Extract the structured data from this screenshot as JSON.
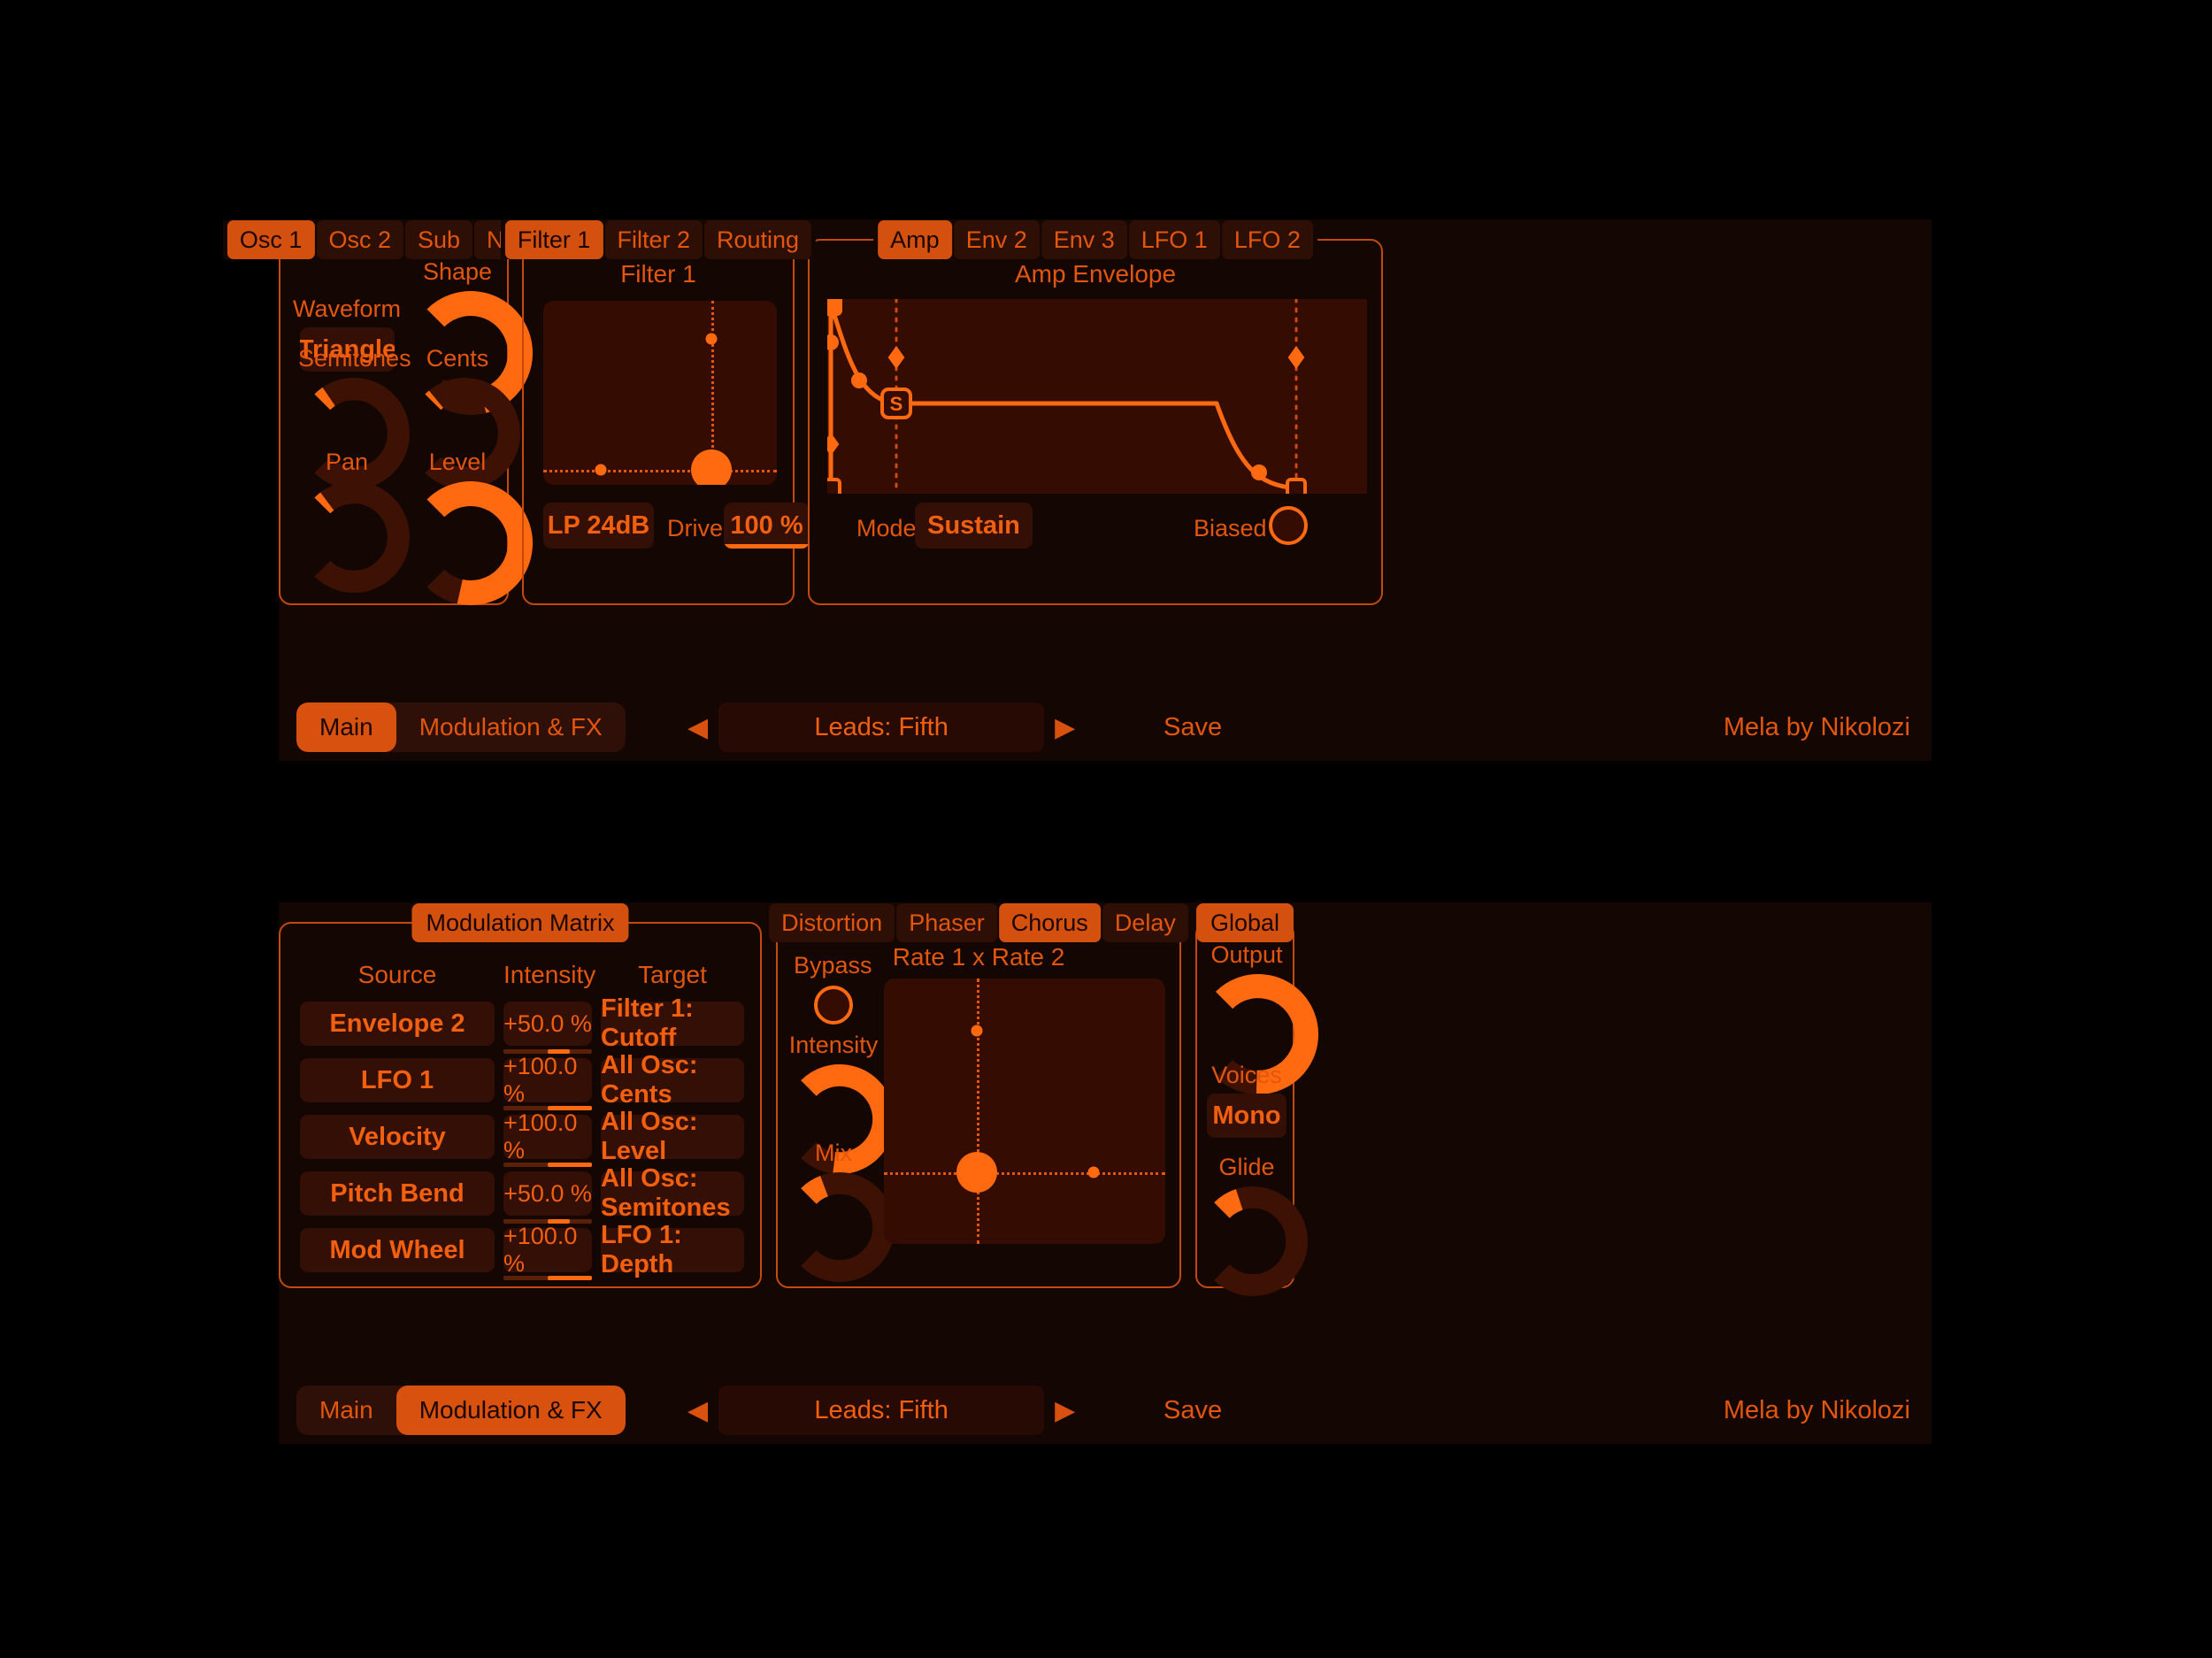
{
  "brand": "Mela by Nikolozi",
  "window_main": {
    "osc": {
      "tabs": [
        {
          "label": "Osc 1",
          "active": true
        },
        {
          "label": "Osc 2",
          "active": false
        },
        {
          "label": "Sub",
          "active": false
        },
        {
          "label": "Noise",
          "active": false
        }
      ],
      "waveform_label": "Waveform",
      "waveform_value": "Triangle",
      "knobs": [
        {
          "label": "Shape",
          "value": 0.78
        },
        {
          "label": "Semitones",
          "value": 0.04
        },
        {
          "label": "Cents",
          "value": 0.02
        },
        {
          "label": "Pan",
          "value": 0.03
        },
        {
          "label": "Level",
          "value": 0.88
        }
      ]
    },
    "filter": {
      "tabs": [
        {
          "label": "Filter 1",
          "active": true
        },
        {
          "label": "Filter 2",
          "active": false
        },
        {
          "label": "Routing",
          "active": false
        }
      ],
      "heading": "Filter 1",
      "cutoff_x": 0.72,
      "resonance_y": 0.92,
      "mod_dot_x": 0.72,
      "mod_dot_y": 0.205,
      "env_dot_x": 0.245,
      "env_dot_y": 0.92,
      "type_value": "LP 24dB",
      "drive_label": "Drive",
      "drive_value": "100 %",
      "drive_fill": 1.0
    },
    "envelope": {
      "tabs": [
        {
          "label": "Amp",
          "active": true
        },
        {
          "label": "Env 2",
          "active": false
        },
        {
          "label": "Env 3",
          "active": false
        },
        {
          "label": "LFO 1",
          "active": false
        },
        {
          "label": "LFO 2",
          "active": false
        }
      ],
      "heading": "Amp Envelope",
      "sustain_marker": "S",
      "mode_label": "Mode",
      "mode_value": "Sustain",
      "biased_label": "Biased",
      "biased_on": false
    },
    "bottom": {
      "segments": [
        {
          "label": "Main",
          "active": true
        },
        {
          "label": "Modulation & FX",
          "active": false
        }
      ],
      "prev_icon": "◀",
      "next_icon": "▶",
      "preset": "Leads: Fifth",
      "save_label": "Save"
    }
  },
  "window_mod": {
    "matrix": {
      "title": "Modulation Matrix",
      "headers": [
        "Source",
        "Intensity",
        "Target"
      ],
      "rows": [
        {
          "source": "Envelope 2",
          "intensity": "+50.0 %",
          "fill": 0.5,
          "target": "Filter 1: Cutoff"
        },
        {
          "source": "LFO 1",
          "intensity": "+100.0 %",
          "fill": 1.0,
          "target": "All Osc: Cents"
        },
        {
          "source": "Velocity",
          "intensity": "+100.0 %",
          "fill": 1.0,
          "target": "All Osc: Level"
        },
        {
          "source": "Pitch Bend",
          "intensity": "+50.0 %",
          "fill": 0.5,
          "target": "All Osc: Semitones"
        },
        {
          "source": "Mod Wheel",
          "intensity": "+100.0 %",
          "fill": 1.0,
          "target": "LFO 1: Depth"
        }
      ]
    },
    "fx": {
      "tabs": [
        {
          "label": "Distortion",
          "active": false
        },
        {
          "label": "Phaser",
          "active": false
        },
        {
          "label": "Chorus",
          "active": true
        },
        {
          "label": "Delay",
          "active": false
        }
      ],
      "heading": "Rate 1  x  Rate 2",
      "bypass_label": "Bypass",
      "bypass_on": false,
      "knobs": [
        {
          "label": "Intensity",
          "value": 0.86
        },
        {
          "label": "Mix",
          "value": 0.09
        }
      ],
      "pad": {
        "main_x": 0.33,
        "main_y": 0.73,
        "dot1_x": 0.33,
        "dot1_y": 0.195,
        "dot2_x": 0.745,
        "dot2_y": 0.73
      }
    },
    "global": {
      "title": "Global",
      "output_label": "Output",
      "output_value": 0.84,
      "voices_label": "Voices",
      "voices_value": "Mono",
      "glide_label": "Glide",
      "glide_value": 0.1
    },
    "bottom": {
      "segments": [
        {
          "label": "Main",
          "active": false
        },
        {
          "label": "Modulation & FX",
          "active": true
        }
      ],
      "prev_icon": "◀",
      "next_icon": "▶",
      "preset": "Leads: Fifth",
      "save_label": "Save"
    }
  },
  "colors": {
    "accent": "#ff6a10",
    "accent_dim": "#e2560d",
    "panel_bg": "#140603",
    "field_bg": "#330f05",
    "pad_bg": "#350c02",
    "track_dim": "#5a2008"
  }
}
